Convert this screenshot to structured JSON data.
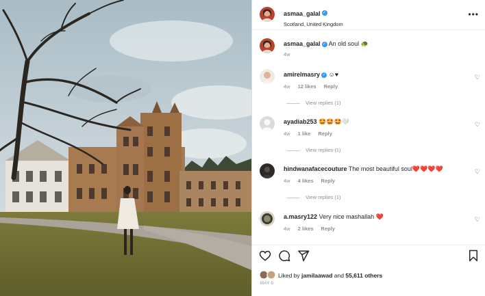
{
  "post": {
    "username": "asmaa_galal",
    "location": "Scotland, United Kingdom",
    "caption_user": "asmaa_galal",
    "caption_text": "An old soul",
    "caption_emoji": "🐢",
    "caption_time": "4w",
    "more_label": "•••"
  },
  "comments": [
    {
      "user": "amirelmasry",
      "verified": true,
      "text": "☺♥",
      "time": "4w",
      "likes": "12 likes",
      "reply": "Reply",
      "view_replies": "View replies (1)"
    },
    {
      "user": "ayadiab253",
      "verified": false,
      "text": "🤩🤩🤩🤍",
      "time": "4w",
      "likes": "1 like",
      "reply": "Reply",
      "view_replies": "View replies (1)"
    },
    {
      "user": "hindwanafacecouture",
      "verified": false,
      "text": "The most beautiful soul❤️❤️❤️❤️",
      "time": "4w",
      "likes": "4 likes",
      "reply": "Reply",
      "view_replies": "View replies (1)"
    },
    {
      "user": "a.masry122",
      "verified": false,
      "text": "Very nice mashallah ❤️",
      "time": "4w",
      "likes": "2 likes",
      "reply": "Reply"
    }
  ],
  "footer": {
    "liked_by_prefix": "Liked by",
    "liked_by_user": "jamilaawad",
    "liked_by_and": "and",
    "others": "55,611 others",
    "date": "MAY 5"
  },
  "icons": {
    "like": "heart-icon",
    "comment": "comment-icon",
    "share": "send-icon",
    "save": "bookmark-icon",
    "verified": "verified-badge-icon"
  },
  "colors": {
    "verified": "#3897f0",
    "text": "#262626",
    "muted": "#8e8e8e"
  }
}
